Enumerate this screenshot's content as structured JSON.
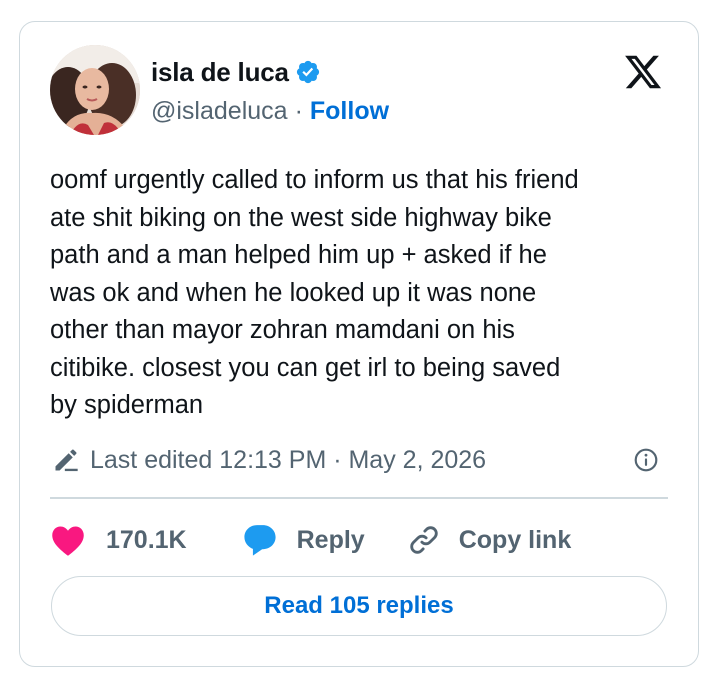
{
  "author": {
    "display_name": "isla de luca",
    "handle": "@isladeluca",
    "separator": "·",
    "follow_label": "Follow",
    "verified": true,
    "avatar_icon": "profile-photo"
  },
  "tweet": {
    "text": "oomf urgently called to inform us that his friend\nate shit biking on the west side highway bike\npath and a man helped him up + asked if he\nwas ok and when he looked up it was none\nother than mayor zohran mamdani on his\ncitibike. closest you can get irl to being saved\nby spiderman"
  },
  "meta": {
    "edited_text": "Last edited 12:13 PM · May 2, 2026",
    "edit_icon": "pencil-icon",
    "info_icon": "info-icon"
  },
  "actions": {
    "like_count": "170.1K",
    "reply_label": "Reply",
    "copy_label": "Copy link"
  },
  "footer": {
    "read_replies_label": "Read 105 replies"
  },
  "colors": {
    "accent": "#006fd6",
    "verified_blue": "#1d9bf0",
    "like_pink": "#f91880",
    "text_primary": "#0f1419",
    "text_secondary": "#536471",
    "border": "#cfd9de"
  }
}
